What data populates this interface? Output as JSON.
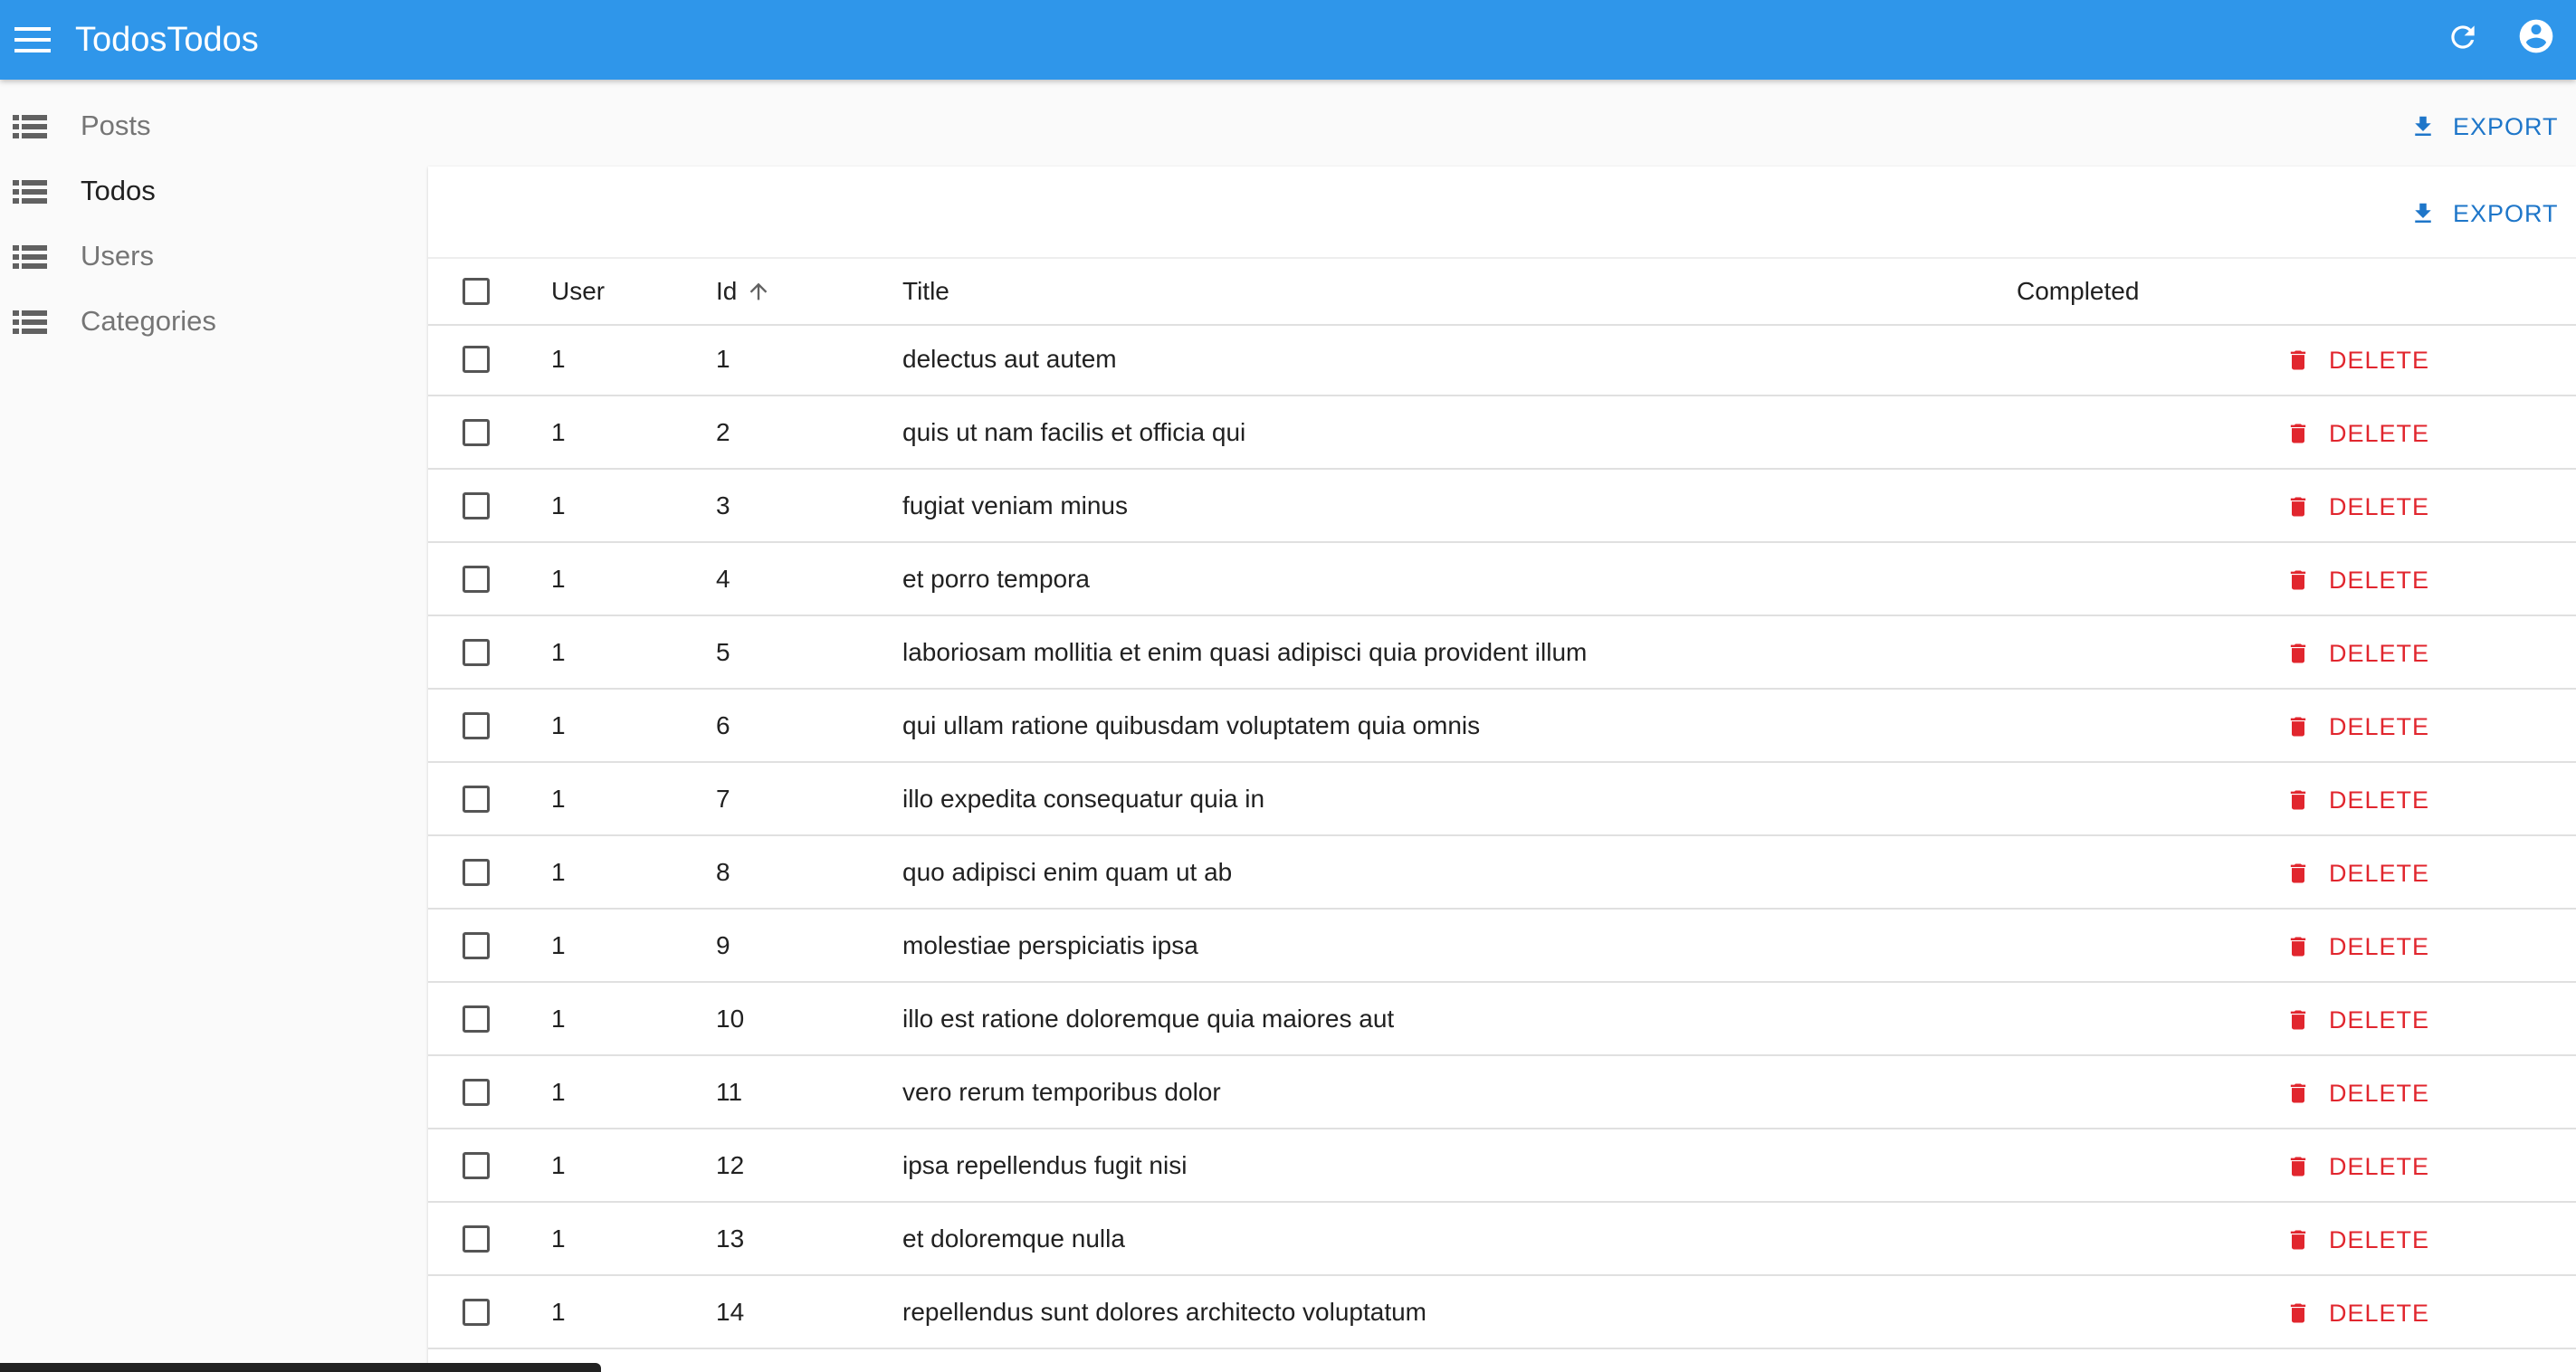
{
  "app": {
    "title": "TodosTodos",
    "colors": {
      "appbar": "#2f96ea",
      "accent": "#1e76c9",
      "danger": "#e1262e"
    },
    "icons": {
      "menu": "menu-icon",
      "refresh": "refresh-icon",
      "account": "account-circle-icon"
    }
  },
  "sidebar": {
    "items": [
      {
        "label": "Posts",
        "icon": "list-icon",
        "active": false
      },
      {
        "label": "Todos",
        "icon": "list-icon",
        "active": true
      },
      {
        "label": "Users",
        "icon": "list-icon",
        "active": false
      },
      {
        "label": "Categories",
        "icon": "list-icon",
        "active": false
      }
    ]
  },
  "toolbar": {
    "export_label": "EXPORT"
  },
  "card": {
    "export_label": "EXPORT"
  },
  "table": {
    "columns": {
      "user": "User",
      "id": "Id",
      "title": "Title",
      "completed": "Completed"
    },
    "sort": {
      "column": "Id",
      "direction": "ascending"
    },
    "delete_label": "DELETE",
    "rows": [
      {
        "user": "1",
        "id": "1",
        "title": "delectus aut autem"
      },
      {
        "user": "1",
        "id": "2",
        "title": "quis ut nam facilis et officia qui"
      },
      {
        "user": "1",
        "id": "3",
        "title": "fugiat veniam minus"
      },
      {
        "user": "1",
        "id": "4",
        "title": "et porro tempora"
      },
      {
        "user": "1",
        "id": "5",
        "title": "laboriosam mollitia et enim quasi adipisci quia provident illum"
      },
      {
        "user": "1",
        "id": "6",
        "title": "qui ullam ratione quibusdam voluptatem quia omnis"
      },
      {
        "user": "1",
        "id": "7",
        "title": "illo expedita consequatur quia in"
      },
      {
        "user": "1",
        "id": "8",
        "title": "quo adipisci enim quam ut ab"
      },
      {
        "user": "1",
        "id": "9",
        "title": "molestiae perspiciatis ipsa"
      },
      {
        "user": "1",
        "id": "10",
        "title": "illo est ratione doloremque quia maiores aut"
      },
      {
        "user": "1",
        "id": "11",
        "title": "vero rerum temporibus dolor"
      },
      {
        "user": "1",
        "id": "12",
        "title": "ipsa repellendus fugit nisi"
      },
      {
        "user": "1",
        "id": "13",
        "title": "et doloremque nulla"
      },
      {
        "user": "1",
        "id": "14",
        "title": "repellendus sunt dolores architecto voluptatum"
      }
    ]
  }
}
